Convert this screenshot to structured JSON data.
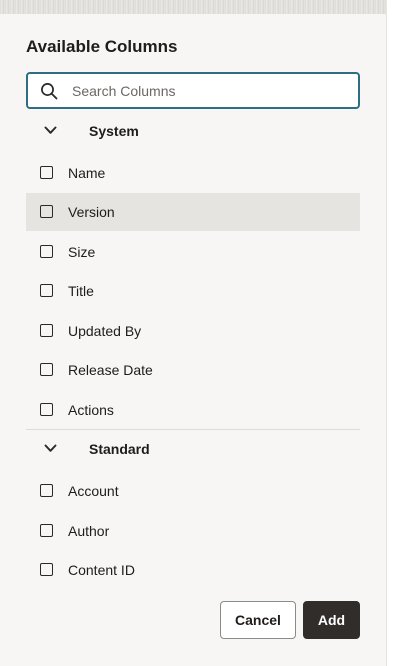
{
  "panel": {
    "title": "Available Columns"
  },
  "search": {
    "placeholder": "Search Columns",
    "value": ""
  },
  "groups": [
    {
      "label": "System",
      "expanded": true,
      "items": [
        {
          "label": "Name",
          "checked": false
        },
        {
          "label": "Version",
          "checked": false,
          "highlighted": true
        },
        {
          "label": "Size",
          "checked": false
        },
        {
          "label": "Title",
          "checked": false
        },
        {
          "label": "Updated By",
          "checked": false
        },
        {
          "label": "Release Date",
          "checked": false
        },
        {
          "label": "Actions",
          "checked": false
        }
      ]
    },
    {
      "label": "Standard",
      "expanded": true,
      "items": [
        {
          "label": "Account",
          "checked": false
        },
        {
          "label": "Author",
          "checked": false
        },
        {
          "label": "Content ID",
          "checked": false
        }
      ]
    }
  ],
  "footer": {
    "cancel_label": "Cancel",
    "add_label": "Add"
  },
  "colors": {
    "focus_border": "#2e6e82",
    "primary_button": "#312d2a",
    "highlight_row": "#e6e4e1",
    "panel_background": "#f7f6f4"
  },
  "icons": {
    "search": "search-icon",
    "group_toggle": "chevron-down-icon",
    "checkbox": "checkbox-unchecked"
  }
}
